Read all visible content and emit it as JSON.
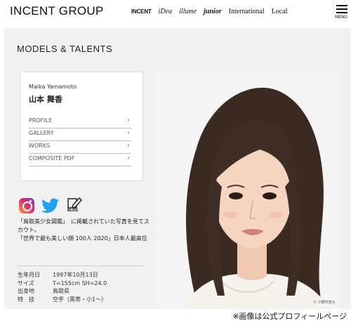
{
  "header": {
    "logo": "INCENT GROUP",
    "nav": [
      {
        "label": "INCENT",
        "style": "incent"
      },
      {
        "label": "iDea",
        "style": "idea"
      },
      {
        "label": "illume",
        "style": "illume"
      },
      {
        "label": "junior",
        "style": "junior"
      },
      {
        "label": "International",
        "style": "plain"
      },
      {
        "label": "Local",
        "style": "plain"
      }
    ],
    "menu_label": "MENU"
  },
  "section_title": "MODELS & TALENTS",
  "profile": {
    "name_en": "Maika Yamamoto",
    "name_jp": "山本 舞香",
    "links": [
      "PROFILE",
      "GALLERY",
      "WORKS",
      "COMPOSITE PDF"
    ],
    "chevron": "›"
  },
  "social": {
    "icons": [
      "instagram-icon",
      "twitter-icon",
      "blog-icon"
    ],
    "blog_label": "BLOG"
  },
  "description": [
    "「鳥取美少女図鑑」　に掲載されていた写真を見てスカウト。",
    "「世界で最も美しい顔 100人 2020」日本人最高位"
  ],
  "info": [
    {
      "label": "生年月日",
      "value": "1997年10月13日"
    },
    {
      "label": "サイズ",
      "value": "T=155cm SH=24.0"
    },
    {
      "label": "出身地",
      "value": "鳥取県"
    },
    {
      "label": "特　技",
      "value": "空手（黒帯・小1〜）"
    }
  ],
  "photo_credit": "© 小野市恵大",
  "caption": "※画像は公式プロフィールページ"
}
